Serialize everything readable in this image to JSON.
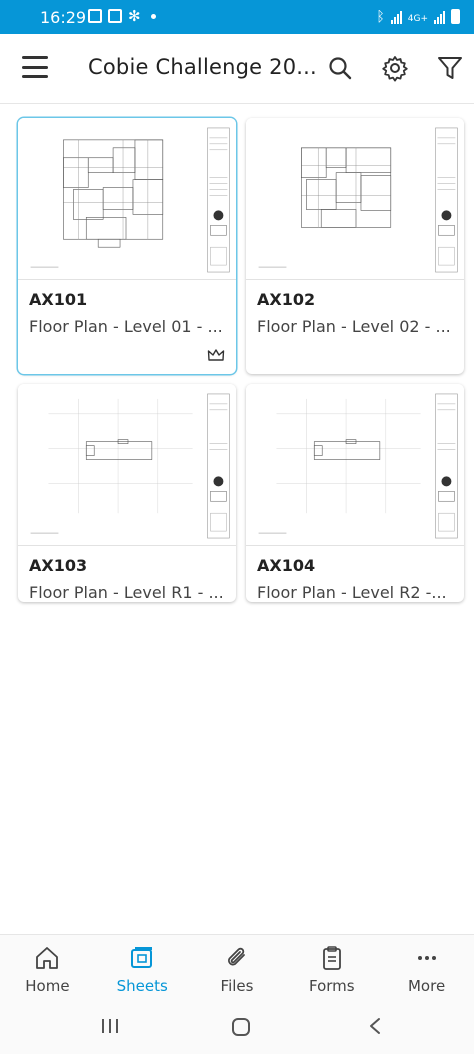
{
  "status_bar": {
    "time": "16:29",
    "network": "4G+"
  },
  "app_bar": {
    "title": "Cobie Challenge 20..."
  },
  "sheets": [
    {
      "code": "AX101",
      "name": "Floor Plan - Level 01 - ...",
      "selected": true,
      "icon": "crown-icon"
    },
    {
      "code": "AX102",
      "name": "Floor Plan - Level 02 - ..."
    },
    {
      "code": "AX103",
      "name": "Floor Plan - Level R1 - ..."
    },
    {
      "code": "AX104",
      "name": "Floor Plan - Level R2 -..."
    }
  ],
  "bottom_nav": [
    {
      "label": "Home",
      "icon": "home-icon"
    },
    {
      "label": "Sheets",
      "icon": "sheets-icon",
      "active": true
    },
    {
      "label": "Files",
      "icon": "paperclip-icon"
    },
    {
      "label": "Forms",
      "icon": "clipboard-icon"
    },
    {
      "label": "More",
      "icon": "more-icon"
    }
  ],
  "colors": {
    "accent": "#0696d7",
    "status_bar": "#0696d7",
    "selected_border": "#6cc7e8"
  }
}
